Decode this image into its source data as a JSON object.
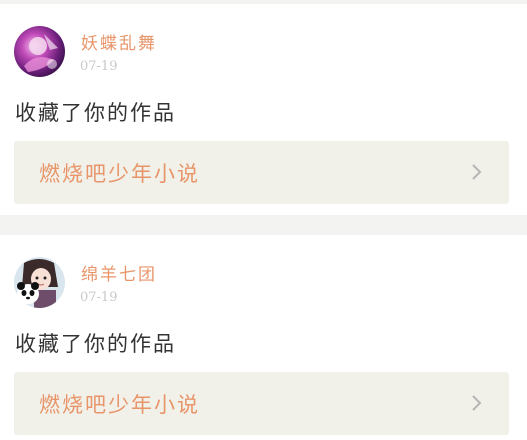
{
  "feed": {
    "items": [
      {
        "username": "妖蝶乱舞",
        "date": "07-19",
        "action": "收藏了你的作品",
        "work_title": "燃烧吧少年小说",
        "avatar_icon": "avatar-anime-purple"
      },
      {
        "username": "绵羊七团",
        "date": "07-19",
        "action": "收藏了你的作品",
        "work_title": "燃烧吧少年小说",
        "avatar_icon": "avatar-anime-girl-with-panda"
      }
    ]
  },
  "colors": {
    "accent": "#e8956a",
    "link_bg": "#f1f1ea",
    "date": "#c9c9c9",
    "text": "#333333",
    "separator": "#f3f3f1"
  }
}
